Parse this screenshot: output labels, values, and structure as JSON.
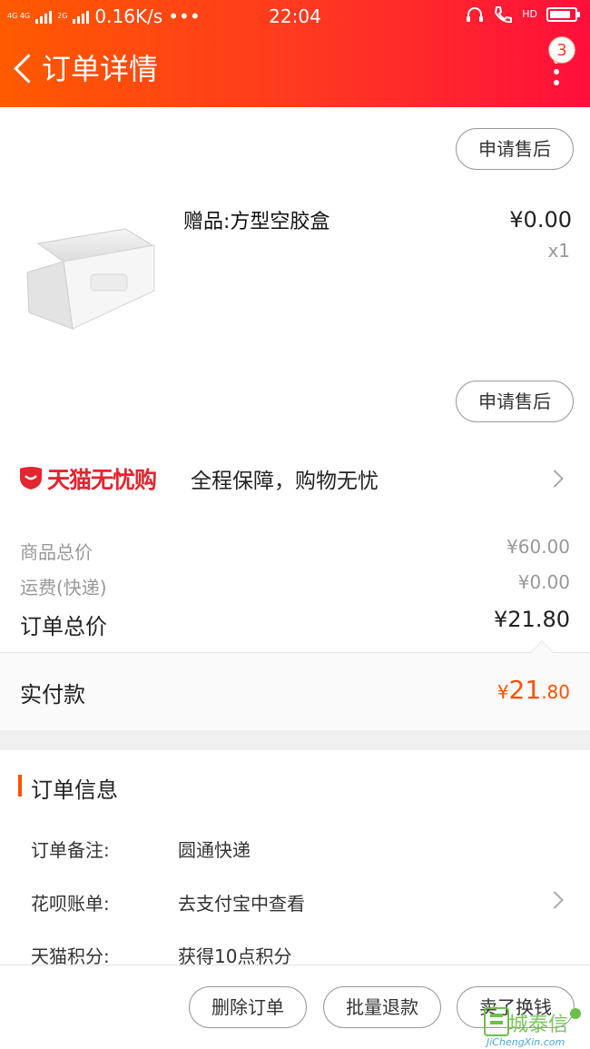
{
  "status_bar": {
    "network_small": "4G 4G",
    "network_small2": "2G",
    "speed": "0.16K/s",
    "more": "•••",
    "time": "22:04",
    "hd": "HD",
    "battery_level": 0.85
  },
  "nav": {
    "title": "订单详情",
    "badge_count": "3"
  },
  "product": {
    "after_sale_top": "申请售后",
    "name": "赠品:方型空胶盒",
    "price": "¥0.00",
    "qty": "x1",
    "after_sale_bottom": "申请售后"
  },
  "guarantee": {
    "brand": "天猫无忧购",
    "text": "全程保障，购物无忧"
  },
  "summary": {
    "goods_label": "商品总价",
    "goods_value": "¥60.00",
    "shipping_label": "运费(快递)",
    "shipping_value": "¥0.00",
    "order_total_label": "订单总价",
    "order_total_value": "¥21.80",
    "paid_label": "实付款",
    "paid_symbol": "¥",
    "paid_int": "21",
    "paid_dec": ".80"
  },
  "order_info": {
    "title": "订单信息",
    "rows": [
      {
        "label": "订单备注:",
        "value": "圆通快递"
      },
      {
        "label": "花呗账单:",
        "value": "去支付宝中查看"
      },
      {
        "label": "天猫积分:",
        "value": "获得10点积分"
      }
    ]
  },
  "actions": {
    "delete": "删除订单",
    "batch_refund": "批量退款",
    "sell_swap": "卖了换钱"
  },
  "watermark": {
    "text": "城泰信",
    "url": "JiChengXin.com"
  },
  "colors": {
    "brand_red": "#e4242e",
    "accent_orange": "#ff5000",
    "header_gradient_start": "#ff5a00",
    "header_gradient_end": "#ff0f3c"
  }
}
